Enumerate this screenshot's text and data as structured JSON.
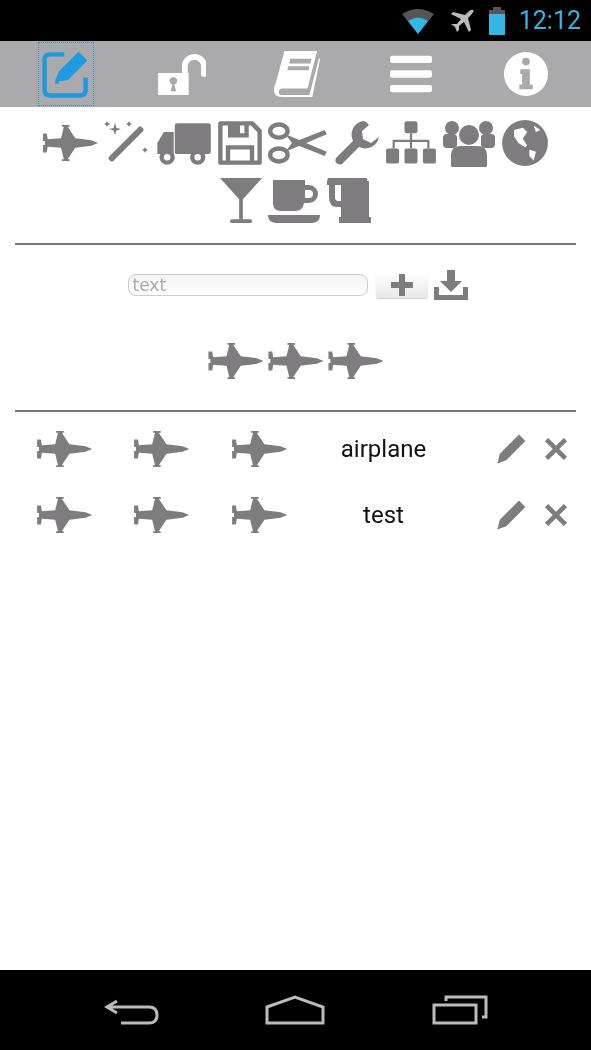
{
  "status_bar": {
    "time": "12:12"
  },
  "toolbar": [
    {
      "kind": "edit",
      "selected": true
    },
    {
      "kind": "unlock",
      "selected": false
    },
    {
      "kind": "book",
      "selected": false
    },
    {
      "kind": "menu",
      "selected": false
    },
    {
      "kind": "info",
      "selected": false
    }
  ],
  "palette": [
    [
      {
        "kind": "jet"
      },
      {
        "kind": "wand"
      },
      {
        "kind": "truck"
      },
      {
        "kind": "floppy"
      },
      {
        "kind": "scissors"
      },
      {
        "kind": "wrench"
      },
      {
        "kind": "sitemap"
      },
      {
        "kind": "users"
      },
      {
        "kind": "globe"
      }
    ],
    [
      {
        "kind": "martini"
      },
      {
        "kind": "coffee"
      },
      {
        "kind": "mug"
      }
    ]
  ],
  "entry": {
    "placeholder": "text",
    "preview": [
      {
        "kind": "jet"
      },
      {
        "kind": "jet"
      },
      {
        "kind": "jet"
      }
    ]
  },
  "items": [
    {
      "icons": [
        {
          "kind": "jet"
        },
        {
          "kind": "jet"
        },
        {
          "kind": "jet"
        }
      ],
      "label": "airplane"
    },
    {
      "icons": [
        {
          "kind": "jet"
        },
        {
          "kind": "jet"
        },
        {
          "kind": "jet"
        }
      ],
      "label": "test"
    }
  ]
}
